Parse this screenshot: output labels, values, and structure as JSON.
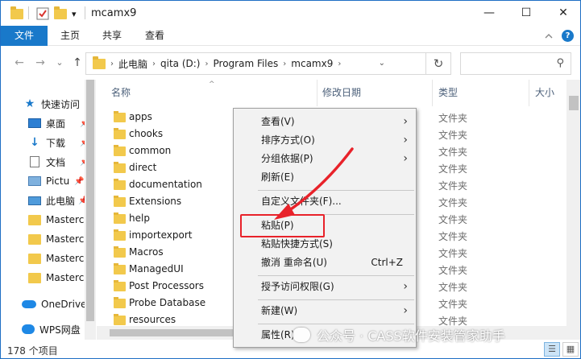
{
  "window": {
    "title": "mcamx9",
    "qat_dropdown": "▾",
    "controls": {
      "minimize": "—",
      "maximize": "☐",
      "close": "✕"
    }
  },
  "ribbon": {
    "tabs": [
      "文件",
      "主页",
      "共享",
      "查看"
    ],
    "collapse_icon": "chevron-up-icon",
    "help_label": "?"
  },
  "nav": {
    "back": "←",
    "forward": "→",
    "recent": "⌄",
    "up": "↑",
    "address_segments": [
      "此电脑",
      "qita (D:)",
      "Program Files",
      "mcamx9"
    ],
    "address_sep": "›",
    "refresh": "↻",
    "search_placeholder": "",
    "search_icon": "⚲"
  },
  "navpane": {
    "items": [
      {
        "label": "快速访问",
        "icon": "star-icon",
        "pinned": false
      },
      {
        "label": "桌面",
        "icon": "desktop-icon",
        "pinned": true
      },
      {
        "label": "下载",
        "icon": "download-icon",
        "pinned": true
      },
      {
        "label": "文档",
        "icon": "document-icon",
        "pinned": true
      },
      {
        "label": "Pictu",
        "icon": "pictures-icon",
        "pinned": true
      },
      {
        "label": "此电脑",
        "icon": "computer-icon",
        "pinned": true
      },
      {
        "label": "Mastercı",
        "icon": "folder-icon",
        "pinned": false
      },
      {
        "label": "Mastercı",
        "icon": "folder-icon",
        "pinned": false
      },
      {
        "label": "Mastercı",
        "icon": "folder-icon",
        "pinned": false
      },
      {
        "label": "Mastercı",
        "icon": "folder-icon",
        "pinned": false
      },
      {
        "label": "OneDrive",
        "icon": "cloud-icon",
        "pinned": false
      },
      {
        "label": "WPS网盘",
        "icon": "wps-cloud-icon",
        "pinned": false
      }
    ],
    "pin_glyph": "📌"
  },
  "columns": {
    "name": "名称",
    "modified": "修改日期",
    "type": "类型",
    "size": "大小",
    "sort_arrow": "^"
  },
  "files": [
    {
      "name": "apps",
      "type": "文件夹"
    },
    {
      "name": "chooks",
      "type": "文件夹"
    },
    {
      "name": "common",
      "type": "文件夹"
    },
    {
      "name": "direct",
      "type": "文件夹"
    },
    {
      "name": "documentation",
      "type": "文件夹"
    },
    {
      "name": "Extensions",
      "type": "文件夹"
    },
    {
      "name": "help",
      "type": "文件夹"
    },
    {
      "name": "importexport",
      "type": "文件夹"
    },
    {
      "name": "Macros",
      "type": "文件夹"
    },
    {
      "name": "ManagedUI",
      "type": "文件夹"
    },
    {
      "name": "Post Processors",
      "type": "文件夹"
    },
    {
      "name": "Probe Database",
      "type": "文件夹"
    },
    {
      "name": "resources",
      "type": "文件夹"
    }
  ],
  "context_menu": {
    "items": [
      {
        "label": "查看(V)",
        "submenu": true
      },
      {
        "label": "排序方式(O)",
        "submenu": true
      },
      {
        "label": "分组依据(P)",
        "submenu": true
      },
      {
        "label": "刷新(E)",
        "submenu": false
      },
      {
        "label": "自定义文件夹(F)...",
        "submenu": false
      },
      {
        "label": "粘贴(P)",
        "submenu": false,
        "highlighted": true
      },
      {
        "label": "粘贴快捷方式(S)",
        "submenu": false
      },
      {
        "label": "撤消 重命名(U)",
        "submenu": false,
        "shortcut": "Ctrl+Z"
      },
      {
        "label": "授予访问权限(G)",
        "submenu": true
      },
      {
        "label": "新建(W)",
        "submenu": true
      },
      {
        "label": "属性(R)",
        "submenu": false
      }
    ],
    "submenu_arrow": "›"
  },
  "status": {
    "text": "178 个项目"
  },
  "view_buttons": {
    "details": "☰",
    "large_icons": "▦"
  },
  "watermark": {
    "text": "公众号 · CASS软件安装管家助手"
  },
  "colors": {
    "accent": "#1979ca",
    "highlight_red": "#e8222a",
    "folder": "#f2c94c",
    "menu_bg": "#f2f2f2"
  }
}
